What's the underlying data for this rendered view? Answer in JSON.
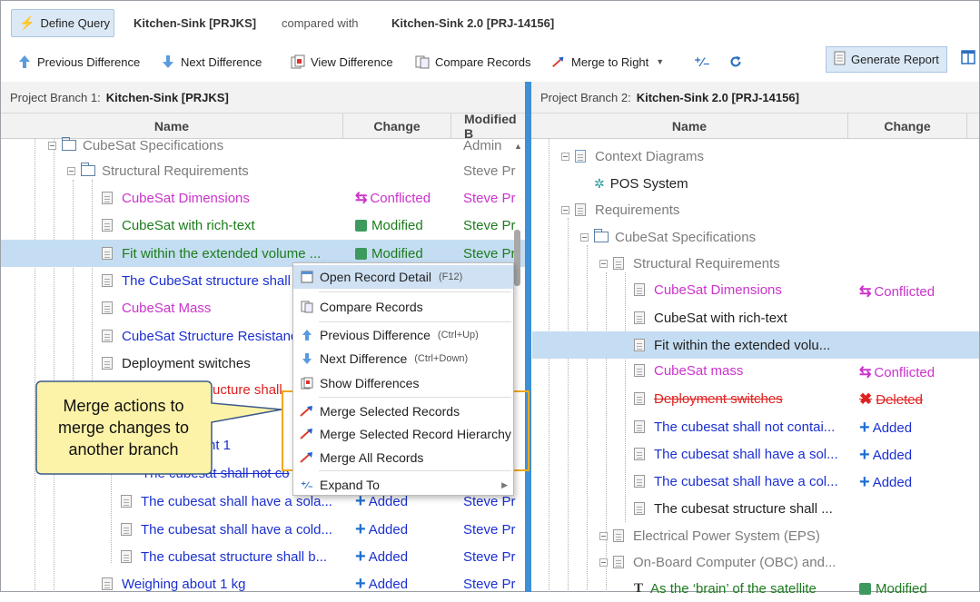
{
  "header": {
    "define_query": "Define Query",
    "left_project": "Kitchen-Sink [PRJKS]",
    "compared_with": "compared with",
    "right_project": "Kitchen-Sink 2.0 [PRJ-14156]"
  },
  "toolbar": {
    "previous_difference": "Previous Difference",
    "next_difference": "Next Difference",
    "view_difference": "View Difference",
    "compare_records": "Compare Records",
    "merge_to_right": "Merge to Right",
    "generate_report": "Generate Report"
  },
  "left_panel": {
    "title_prefix": "Project Branch 1:",
    "title_name": "Kitchen-Sink [PRJKS]",
    "columns": [
      "Name",
      "Change",
      "Modified B"
    ],
    "rows": [
      {
        "name": "CubeSat Specifications",
        "change": "",
        "modified": "Admin"
      },
      {
        "name": "Structural Requirements",
        "change": "",
        "modified": "Steve Pr"
      },
      {
        "name": "CubeSat Dimensions",
        "change": "Conflicted",
        "modified": "Steve Pr"
      },
      {
        "name": "CubeSat with rich-text",
        "change": "Modified",
        "modified": "Steve Pr"
      },
      {
        "name": "Fit within the extended volume ...",
        "change": "Modified",
        "modified": "Steve Pr"
      },
      {
        "name": "The CubeSat structure shall",
        "change": "",
        "modified": ""
      },
      {
        "name": "CubeSat Mass",
        "change": "",
        "modified": ""
      },
      {
        "name": "CubeSat Structure Resistanc",
        "change": "",
        "modified": ""
      },
      {
        "name": "Deployment switches",
        "change": "",
        "modified": ""
      },
      {
        "name": "ructure shall",
        "change": "",
        "modified": ""
      },
      {
        "name": "nt 1",
        "change": "",
        "modified": ""
      },
      {
        "name": "The cubesat shall not co",
        "change": "",
        "modified": ""
      },
      {
        "name": "The cubesat shall have a sola...",
        "change": "Added",
        "modified": "Steve Pr"
      },
      {
        "name": "The cubesat shall have a cold...",
        "change": "Added",
        "modified": "Steve Pr"
      },
      {
        "name": "The cubesat structure shall b...",
        "change": "Added",
        "modified": "Steve Pr"
      },
      {
        "name": "Weighing about 1 kg",
        "change": "Added",
        "modified": "Steve Pr"
      }
    ]
  },
  "right_panel": {
    "title_prefix": "Project Branch 2:",
    "title_name": "Kitchen-Sink 2.0 [PRJ-14156]",
    "columns": [
      "Name",
      "Change"
    ],
    "rows": [
      {
        "name": "Context Diagrams",
        "change": ""
      },
      {
        "name": "POS System",
        "change": ""
      },
      {
        "name": "Requirements",
        "change": ""
      },
      {
        "name": "CubeSat Specifications",
        "change": ""
      },
      {
        "name": "Structural Requirements",
        "change": ""
      },
      {
        "name": "CubeSat Dimensions",
        "change": "Conflicted"
      },
      {
        "name": "CubeSat with rich-text",
        "change": ""
      },
      {
        "name": "Fit within the extended volu...",
        "change": ""
      },
      {
        "name": "CubeSat mass",
        "change": "Conflicted"
      },
      {
        "name": "Deployment switches",
        "change": "Deleted"
      },
      {
        "name": "The cubesat shall not contai...",
        "change": "Added"
      },
      {
        "name": "The cubesat shall have a sol...",
        "change": "Added"
      },
      {
        "name": "The cubesat shall have a col...",
        "change": "Added"
      },
      {
        "name": "The cubesat structure shall ...",
        "change": ""
      },
      {
        "name": "Electrical Power System (EPS)",
        "change": ""
      },
      {
        "name": "On-Board Computer (OBC) and...",
        "change": ""
      },
      {
        "name": "As the ‘brain’ of the satellite",
        "change": "Modified"
      }
    ]
  },
  "context_menu": {
    "open_record_detail": "Open Record Detail",
    "open_record_detail_shortcut": "(F12)",
    "compare_records": "Compare Records",
    "previous_difference": "Previous Difference",
    "previous_difference_shortcut": "(Ctrl+Up)",
    "next_difference": "Next Difference",
    "next_difference_shortcut": "(Ctrl+Down)",
    "show_differences": "Show Differences",
    "merge_selected_records": "Merge Selected Records",
    "merge_selected_record_hierarchy": "Merge Selected Record Hierarchy",
    "merge_all_records": "Merge All Records",
    "expand_to": "Expand To"
  },
  "callout": {
    "line1": "Merge actions to",
    "line2": "merge changes to",
    "line3": "another branch"
  },
  "colors": {
    "accent": "#3f8fd6",
    "conflicted": "#cc33cc",
    "modified": "#1c7c1c",
    "added": "#1a2fd0",
    "deleted": "#e02020",
    "callout_fill": "#fdf3a8",
    "callout_border": "#f0a81c"
  }
}
